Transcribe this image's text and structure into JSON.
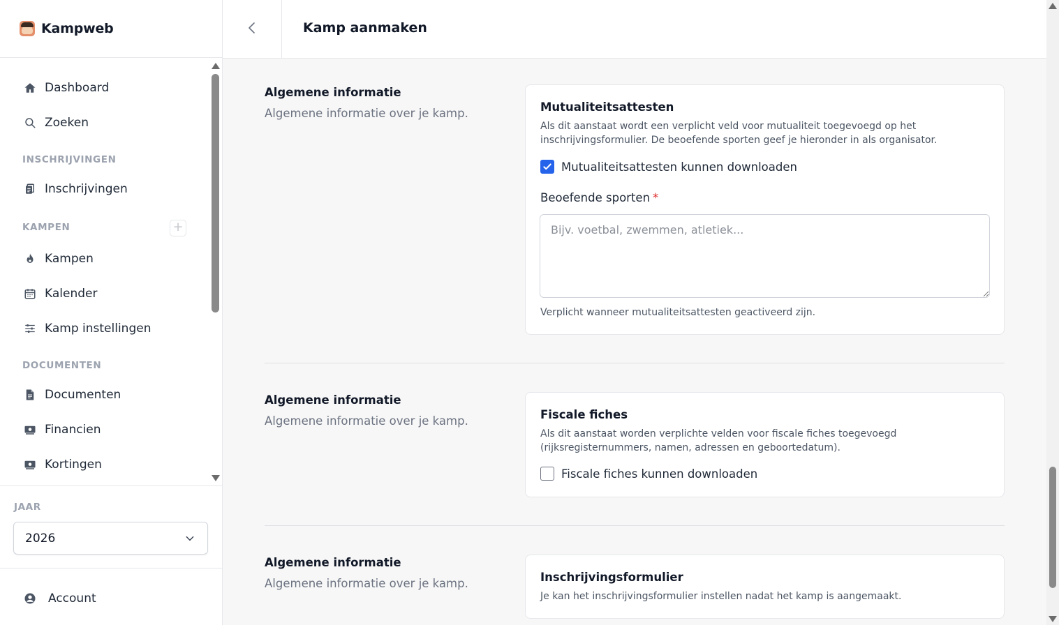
{
  "app": {
    "name": "Kampweb"
  },
  "header": {
    "title": "Kamp aanmaken"
  },
  "sidebar": {
    "items": {
      "dashboard": "Dashboard",
      "zoeken": "Zoeken",
      "inschrijvingen": "Inschrijvingen",
      "kampen": "Kampen",
      "kalender": "Kalender",
      "kamp_instellingen": "Kamp instellingen",
      "documenten": "Documenten",
      "financien": "Financien",
      "kortingen": "Kortingen"
    },
    "sections": {
      "inschrijvingen": "INSCHRIJVINGEN",
      "kampen": "KAMPEN",
      "documenten": "DOCUMENTEN"
    },
    "add_symbol": "+",
    "year": {
      "label": "JAAR",
      "value": "2026"
    },
    "account": "Account"
  },
  "sections": [
    {
      "title": "Algemene informatie",
      "description": "Algemene informatie over je kamp.",
      "card": {
        "title": "Mutualiteitsattesten",
        "text": "Als dit aanstaat wordt een verplicht veld voor mutualiteit toegevoegd op het inschrijvingsformulier. De beoefende sporten geef je hieronder in als organisator.",
        "checkbox_label": "Mutualiteitsattesten kunnen downloaden",
        "checked": true,
        "field_label": "Beoefende sporten",
        "required_mark": "*",
        "placeholder": "Bijv. voetbal, zwemmen, atletiek...",
        "hint": "Verplicht wanneer mutualiteitsattesten geactiveerd zijn."
      }
    },
    {
      "title": "Algemene informatie",
      "description": "Algemene informatie over je kamp.",
      "card": {
        "title": "Fiscale fiches",
        "text": "Als dit aanstaat worden verplichte velden voor fiscale fiches toegevoegd (rijksregisternummers, namen, adressen en geboortedatum).",
        "checkbox_label": "Fiscale fiches kunnen downloaden",
        "checked": false
      }
    },
    {
      "title": "Algemene informatie",
      "description": "Algemene informatie over je kamp.",
      "card": {
        "title": "Inschrijvingsformulier",
        "text": "Je kan het inschrijvingsformulier instellen nadat het kamp is aangemaakt."
      }
    }
  ],
  "colors": {
    "accent": "#2563eb",
    "required": "#dc2626",
    "muted": "#6b7280"
  }
}
